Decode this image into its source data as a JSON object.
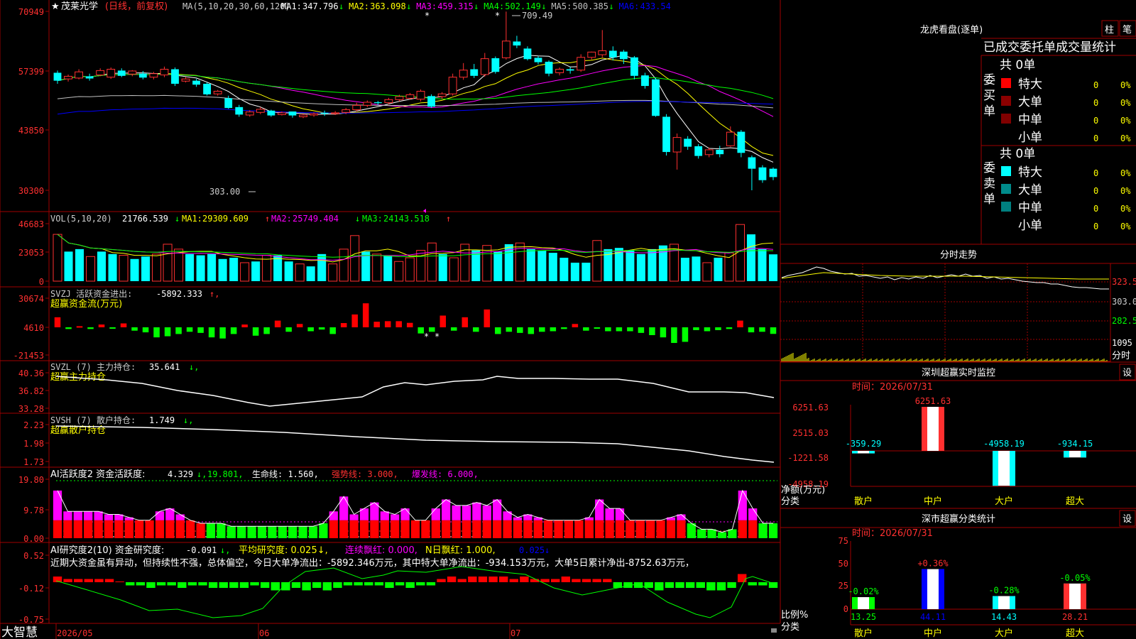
{
  "header": {
    "star": "★",
    "stock_name": "茂莱光学",
    "period": "(日线，前复权)",
    "ma_params": "MA(5,10,20,30,60,120)",
    "ma": [
      {
        "label": "MA1:",
        "value": "347.796",
        "arrow": "↓",
        "color": "#ffffff"
      },
      {
        "label": "MA2:",
        "value": "363.098",
        "arrow": "↓",
        "color": "#ffff00"
      },
      {
        "label": "MA3:",
        "value": "459.315",
        "arrow": "↓",
        "color": "#ff00ff"
      },
      {
        "label": "MA4:",
        "value": "502.149",
        "arrow": "↓",
        "color": "#00ff00"
      },
      {
        "label": "MA5:",
        "value": "500.385",
        "arrow": "↓",
        "color": "#c0c0c0"
      },
      {
        "label": "MA6:",
        "value": "433.54",
        "arrow": "",
        "color": "#0000ff"
      }
    ]
  },
  "price_panel": {
    "y_ticks": [
      "70949",
      "57399",
      "43850",
      "30300"
    ],
    "high_label": "709.49",
    "low_label": "303.00"
  },
  "vol_panel": {
    "title": "VOL(5,10,20)",
    "vol": {
      "value": "21766.539",
      "arrow": "↓"
    },
    "ma1": {
      "label": "MA1:",
      "value": "29309.609",
      "arrow": "↑"
    },
    "ma2": {
      "label": "MA2:",
      "value": "25749.404",
      "arrow": "↓"
    },
    "ma3": {
      "label": "MA3:",
      "value": "24143.518",
      "arrow": "↑"
    },
    "y_ticks": [
      "46683",
      "23053",
      "0"
    ]
  },
  "svzj_panel": {
    "title": "SVZJ  活跃资金进出:",
    "value": "-5892.333",
    "arrow": "↑,",
    "subtitle": "超赢资金流(万元)",
    "y_ticks": [
      "30674",
      "4610",
      "-21453"
    ]
  },
  "svzl_panel": {
    "title": "SVZL (7) 主力持仓:",
    "value": "35.641",
    "arrow": "↓,",
    "subtitle": "超赢主力持仓",
    "y_ticks": [
      "40.36",
      "36.82",
      "33.28"
    ]
  },
  "svsh_panel": {
    "title": "SVSH (7) 散户持仓:",
    "value": "1.749",
    "arrow": "↓,",
    "subtitle": "超赢散户持仓",
    "y_ticks": [
      "2.23",
      "1.98",
      "1.73"
    ]
  },
  "ai_active_panel": {
    "title": "AI活跃度2 资金活跃度:",
    "value": "4.329",
    "arrow": "↓,",
    "v2": "19.801,",
    "life": "生命线: 1.560,",
    "strong": "强势线: 3.000,",
    "burst": "爆发线: 6.000,",
    "y_ticks": [
      "19.80",
      "9.78",
      "0.00"
    ]
  },
  "ai_research_panel": {
    "title": "AI研究度2(10) 资金研究度:",
    "value": "-0.091",
    "arrow": "↓,",
    "avg": "平均研究度: 0.025↓,",
    "red": "连续飘红: 0.000,",
    "nred": "N日飘红: 1.000,",
    "tail": "0.025↓",
    "comment": "近期大资金虽有异动，但持续性不强，总体偏空，今日大单净流出：-5892.346万元，其中特大单净流出：-934.153万元，大单5日累计净出-8752.63万元，",
    "y_ticks": [
      "0.52",
      "-0.12",
      "-0.75"
    ]
  },
  "x_axis": {
    "labels": [
      "2026/05",
      "06",
      "07"
    ],
    "brand": "大智慧"
  },
  "right": {
    "tab_bar": "龙虎看盘(逐单)",
    "btn_bar": "柱",
    "btn_tick": "笔",
    "order_title": "已成交委托单成交量统计",
    "buy": {
      "side": "委买单",
      "total": "共 0单",
      "rows": [
        {
          "label": "特大",
          "n": "0",
          "pct": "0%",
          "color": "#ff0000"
        },
        {
          "label": "大单",
          "n": "0",
          "pct": "0%",
          "color": "#8b0000"
        },
        {
          "label": "中单",
          "n": "0",
          "pct": "0%",
          "color": "#800000"
        },
        {
          "label": "小单",
          "n": "0",
          "pct": "0%",
          "color": ""
        }
      ]
    },
    "sell": {
      "side": "委卖单",
      "total": "共 0单",
      "rows": [
        {
          "label": "特大",
          "n": "0",
          "pct": "0%",
          "color": "#00ffff"
        },
        {
          "label": "大单",
          "n": "0",
          "pct": "0%",
          "color": "#008b8b"
        },
        {
          "label": "中单",
          "n": "0",
          "pct": "0%",
          "color": "#008080"
        },
        {
          "label": "小单",
          "n": "0",
          "pct": "0%",
          "color": ""
        }
      ]
    },
    "intraday": {
      "title": "分时走势",
      "y_ticks": [
        "323.5",
        "303.0",
        "282.5"
      ],
      "vol_label": "1095",
      "time_label": "分时"
    },
    "monitor": {
      "title": "深圳超赢实时监控",
      "btn": "设",
      "time": "时间：2026/07/31",
      "y_ticks": [
        "6251.63",
        "2515.03",
        "-1221.58",
        "-4958.19"
      ],
      "net_label": "净额(万元)",
      "cat_label": "分类",
      "categories": [
        "散户",
        "中户",
        "大户",
        "超大"
      ],
      "values": [
        -359.29,
        6251.63,
        -4958.19,
        -934.15
      ],
      "value_labels": [
        "-359.29",
        "6251.63",
        "-4958.19",
        "-934.15"
      ]
    },
    "classify": {
      "title": "深市超赢分类统计",
      "btn": "设",
      "time": "时间：2026/07/31",
      "y_ticks": [
        "75",
        "50",
        "25",
        "0"
      ],
      "ratio_label": "比例%",
      "cat_label": "分类",
      "categories": [
        "散户",
        "中户",
        "大户",
        "超大"
      ],
      "values": [
        13.25,
        44.11,
        14.43,
        28.21
      ],
      "value_labels": [
        "13.25",
        "44.11",
        "14.43",
        "28.21"
      ],
      "changes": [
        "-0.02%",
        "+0.36%",
        "-0.28%",
        "-0.05%"
      ]
    }
  },
  "chart_data": {
    "type": "candlestick",
    "title": "茂莱光学 (日线，前复权)",
    "x_labels": [
      "2026/05",
      "06",
      "07"
    ],
    "y_range": [
      30300,
      70949
    ],
    "high": 709.49,
    "low": 303.0,
    "candles": [
      [
        570,
        552,
        575,
        545
      ],
      [
        556,
        562,
        566,
        550
      ],
      [
        558,
        572,
        578,
        555
      ],
      [
        562,
        557,
        568,
        552
      ],
      [
        565,
        575,
        580,
        562
      ],
      [
        560,
        578,
        582,
        556
      ],
      [
        575,
        563,
        580,
        560
      ],
      [
        567,
        574,
        576,
        562
      ],
      [
        568,
        559,
        574,
        555
      ],
      [
        560,
        568,
        572,
        555
      ],
      [
        565,
        578,
        584,
        560
      ],
      [
        578,
        545,
        582,
        540
      ],
      [
        551,
        556,
        560,
        548
      ],
      [
        552,
        543,
        556,
        538
      ],
      [
        545,
        521,
        548,
        518
      ],
      [
        522,
        528,
        531,
        518
      ],
      [
        512,
        490,
        518,
        488
      ],
      [
        492,
        475,
        497,
        470
      ],
      [
        474,
        481,
        485,
        470
      ],
      [
        480,
        487,
        492,
        476
      ],
      [
        484,
        473,
        486,
        470
      ],
      [
        475,
        479,
        482,
        473
      ],
      [
        482,
        473,
        482,
        468
      ],
      [
        470,
        474,
        477,
        467
      ],
      [
        474,
        477,
        480,
        470
      ],
      [
        479,
        477,
        484,
        472
      ],
      [
        477,
        479,
        483,
        474
      ],
      [
        480,
        486,
        490,
        476
      ],
      [
        486,
        496,
        502,
        482
      ],
      [
        496,
        503,
        507,
        492
      ],
      [
        503,
        501,
        506,
        497
      ],
      [
        502,
        509,
        513,
        498
      ],
      [
        509,
        516,
        520,
        505
      ],
      [
        512,
        520,
        524,
        509
      ],
      [
        510,
        528,
        532,
        505
      ],
      [
        517,
        493,
        521,
        490
      ],
      [
        516,
        522,
        526,
        510
      ],
      [
        522,
        560,
        568,
        518
      ],
      [
        560,
        576,
        592,
        554
      ],
      [
        578,
        563,
        590,
        558
      ],
      [
        566,
        602,
        615,
        561
      ],
      [
        603,
        572,
        607,
        568
      ],
      [
        604,
        642,
        709,
        600
      ],
      [
        641,
        632,
        654,
        626
      ],
      [
        625,
        601,
        630,
        598
      ],
      [
        604,
        594,
        608,
        589
      ],
      [
        595,
        568,
        598,
        562
      ],
      [
        570,
        578,
        582,
        564
      ],
      [
        578,
        575,
        583,
        568
      ],
      [
        576,
        605,
        612,
        572
      ],
      [
        605,
        617,
        618,
        600
      ],
      [
        611,
        620,
        667,
        605
      ],
      [
        620,
        605,
        630,
        598
      ],
      [
        618,
        601,
        622,
        590
      ],
      [
        605,
        563,
        608,
        555
      ],
      [
        564,
        540,
        570,
        534
      ],
      [
        555,
        472,
        559,
        470
      ],
      [
        470,
        390,
        476,
        382
      ],
      [
        390,
        423,
        432,
        350
      ],
      [
        420,
        402,
        426,
        395
      ],
      [
        403,
        381,
        408,
        375
      ],
      [
        384,
        395,
        400,
        378
      ],
      [
        395,
        385,
        404,
        378
      ],
      [
        404,
        435,
        448,
        402
      ],
      [
        436,
        388,
        440,
        378
      ],
      [
        378,
        352,
        382,
        303
      ],
      [
        355,
        326,
        360,
        320
      ],
      [
        352,
        333,
        355,
        326
      ]
    ],
    "volume": [
      [
        38000,
        1
      ],
      [
        24000,
        0
      ],
      [
        26000,
        0
      ],
      [
        20000,
        1
      ],
      [
        24000,
        0
      ],
      [
        22000,
        0
      ],
      [
        21000,
        1
      ],
      [
        18000,
        0
      ],
      [
        20000,
        0
      ],
      [
        22000,
        1
      ],
      [
        30000,
        1
      ],
      [
        26000,
        1
      ],
      [
        22000,
        0
      ],
      [
        21000,
        0
      ],
      [
        22000,
        0
      ],
      [
        18000,
        0
      ],
      [
        19000,
        0
      ],
      [
        15000,
        1
      ],
      [
        16000,
        0
      ],
      [
        21000,
        1
      ],
      [
        21000,
        0
      ],
      [
        16000,
        0
      ],
      [
        14000,
        1
      ],
      [
        12000,
        0
      ],
      [
        22000,
        0
      ],
      [
        14000,
        1
      ],
      [
        26000,
        1
      ],
      [
        37000,
        1
      ],
      [
        24000,
        0
      ],
      [
        22000,
        1
      ],
      [
        21000,
        0
      ],
      [
        16000,
        1
      ],
      [
        19000,
        1
      ],
      [
        25000,
        1
      ],
      [
        31000,
        1
      ],
      [
        22000,
        0
      ],
      [
        19000,
        1
      ],
      [
        30000,
        1
      ],
      [
        25000,
        0
      ],
      [
        29000,
        1
      ],
      [
        24000,
        0
      ],
      [
        30000,
        0
      ],
      [
        31000,
        1
      ],
      [
        26000,
        0
      ],
      [
        25000,
        0
      ],
      [
        23000,
        0
      ],
      [
        19000,
        0
      ],
      [
        15000,
        0
      ],
      [
        15000,
        0
      ],
      [
        33000,
        1
      ],
      [
        26000,
        0
      ],
      [
        27000,
        0
      ],
      [
        25000,
        0
      ],
      [
        22000,
        0
      ],
      [
        26000,
        0
      ],
      [
        29000,
        0
      ],
      [
        30000,
        1
      ],
      [
        19000,
        0
      ],
      [
        20000,
        0
      ],
      [
        15000,
        1
      ],
      [
        19000,
        0
      ],
      [
        23000,
        1
      ],
      [
        46000,
        1
      ],
      [
        38000,
        0
      ],
      [
        26000,
        0
      ],
      [
        21766,
        0
      ]
    ],
    "svzj": [
      9000,
      -1500,
      1000,
      -1500,
      2500,
      -1000,
      3500,
      -3000,
      -4500,
      -9000,
      -8000,
      -6000,
      -4000,
      -5000,
      -9000,
      -10000,
      -6000,
      2500,
      -7500,
      -6000,
      6000,
      -4000,
      3000,
      -3500,
      -2000,
      -6000,
      3800,
      11500,
      21500,
      5000,
      5500,
      5500,
      4000,
      -5500,
      -4000,
      10500,
      -3000,
      9000,
      -4000,
      16000,
      -6000,
      -4000,
      -5000,
      -6000,
      -4000,
      -3500,
      -1500,
      3000,
      -3000,
      -1000,
      -3500,
      -3500,
      -3500,
      -5000,
      -7000,
      -9000,
      -14000,
      -13000,
      -2500,
      -3500,
      -2500,
      -1500,
      6000,
      -4500,
      -4000,
      -5892
    ]
  }
}
